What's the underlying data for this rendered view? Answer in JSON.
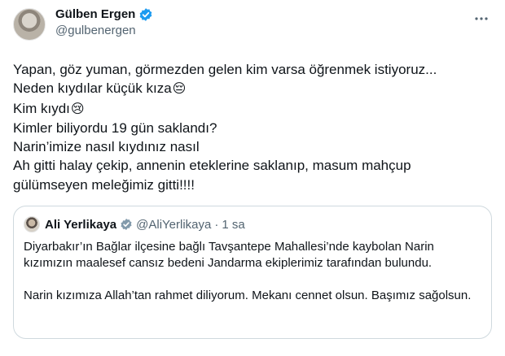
{
  "author": {
    "display_name": "Gülben Ergen",
    "handle": "@gulbenergen",
    "verified_icon": "verified-badge-icon",
    "verified_color": "#1d9bf0"
  },
  "more_icon": "more-icon",
  "tweet": {
    "lines": [
      "Yapan, göz yuman, görmezden gelen kim varsa öğrenmek istiyoruz...",
      "Neden kıydılar küçük kıza",
      "Kim kıydı",
      "Kimler biliyordu 19 gün saklandı?",
      "Narin’imize nasıl kıydınız nasıl",
      "Ah gitti halay çekip, annenin eteklerine saklanıp, masum mahçup",
      "gülümseyen meleğimiz gitti!!!!"
    ],
    "emoji_pensive": "😔",
    "emoji_crying": "😢"
  },
  "quote": {
    "display_name": "Ali Yerlikaya",
    "handle": "@AliYerlikaya",
    "separator": "·",
    "time": "1 sa",
    "badge_icon": "government-badge-icon",
    "badge_color": "#829aab",
    "paragraph1": "Diyarbakır’ın Bağlar ilçesine bağlı Tavşantepe Mahallesi’nde kaybolan Narin kızımızın maalesef cansız bedeni Jandarma ekiplerimiz tarafından bulundu.",
    "paragraph2": "Narin kızımıza Allah’tan rahmet diliyorum. Mekanı cennet olsun. Başımız sağolsun."
  }
}
